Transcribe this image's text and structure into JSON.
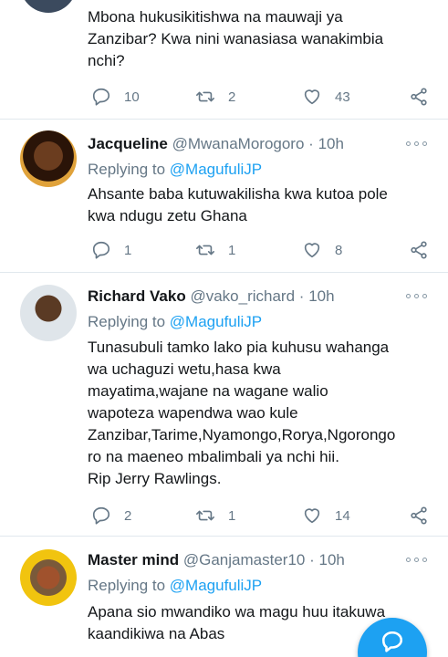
{
  "tweets": [
    {
      "body": "Mbona hukusikitishwa na mauwaji ya\nZanzibar? Kwa nini wanasiasa wanakimbia\nnchi?",
      "replies": "10",
      "retweets": "2",
      "likes": "43"
    },
    {
      "name": "Jacqueline",
      "handle": "@MwanaMorogoro",
      "time": "10h",
      "replying_label": "Replying to",
      "replying_to": "@MagufuliJP",
      "body": "Ahsante baba kutuwakilisha kwa kutoa pole\nkwa  ndugu zetu Ghana",
      "replies": "1",
      "retweets": "1",
      "likes": "8"
    },
    {
      "name": "Richard Vako",
      "handle": "@vako_richard",
      "time": "10h",
      "replying_label": "Replying to",
      "replying_to": "@MagufuliJP",
      "body": "Tunasubuli tamko lako pia kuhusu wahanga\nwa uchaguzi wetu,hasa kwa\nmayatima,wajane na wagane walio\nwapoteza wapendwa wao kule\nZanzibar,Tarime,Nyamongo,Rorya,Ngorongo\nro na maeneo mbalimbali ya nchi hii.\nRip Jerry Rawlings.",
      "replies": "2",
      "retweets": "1",
      "likes": "14"
    },
    {
      "name": "Master mind",
      "handle": "@Ganjamaster10",
      "time": "10h",
      "replying_label": "Replying to",
      "replying_to": "@MagufuliJP",
      "body": "Apana sio mwandiko wa  magu huu itakuwa\nkaandikiwa na Abas"
    }
  ],
  "separator": "·",
  "icons": {
    "reply": "reply-icon",
    "retweet": "retweet-icon",
    "like": "heart-icon",
    "share": "share-icon",
    "more": "more-options-icon",
    "compose": "compose-reply-icon"
  },
  "colors": {
    "accent": "#1da1f2",
    "muted": "#657786",
    "text": "#14171a",
    "divider": "#e1e8ed"
  }
}
